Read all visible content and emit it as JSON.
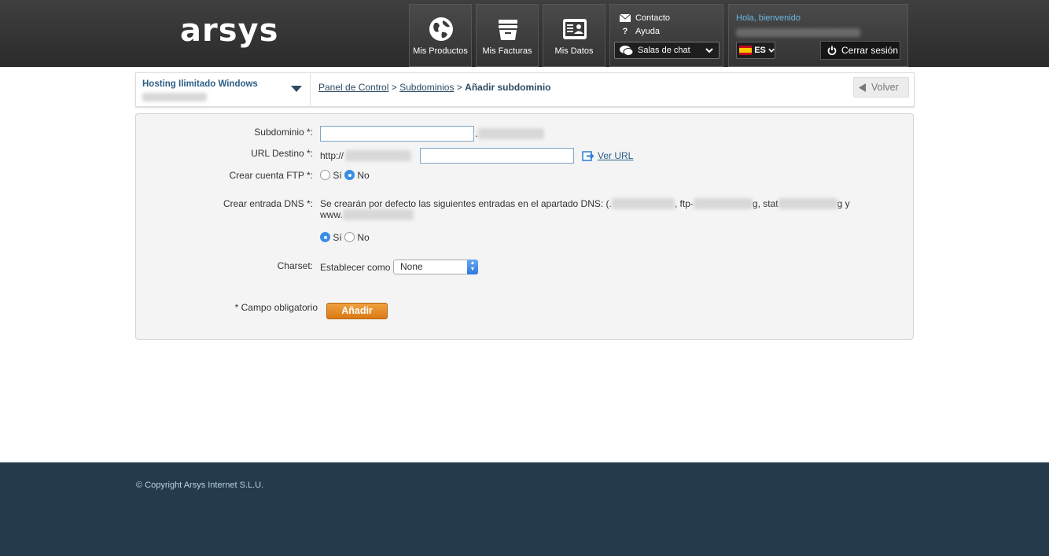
{
  "header": {
    "logo": "arsys",
    "nav": [
      {
        "label": "Mis Productos",
        "icon": "globe-icon"
      },
      {
        "label": "Mis Facturas",
        "icon": "basket-icon"
      },
      {
        "label": "Mis Datos",
        "icon": "id-card-icon"
      }
    ],
    "contact_label": "Contacto",
    "help_label": "Ayuda",
    "chat_label": "Salas de chat",
    "greeting": "Hola, bienvenido",
    "language": "ES",
    "logout_label": "Cerrar sesión"
  },
  "service": {
    "title": "Hosting Ilimitado Windows"
  },
  "breadcrumb": {
    "items": [
      "Panel de Control",
      "Subdominios"
    ],
    "separator": ">",
    "current": "Añadir subdominio"
  },
  "back_label": "Volver",
  "form": {
    "subdomain_label": "Subdominio *:",
    "subdomain_value": "",
    "url_label": "URL Destino *:",
    "url_prefix": "http://",
    "url_value": "",
    "ver_url_label": "Ver URL",
    "ftp_label": "Crear cuenta FTP *:",
    "ftp_options": [
      "Sí",
      "No"
    ],
    "ftp_selected": "No",
    "dns_label": "Crear entrada DNS *:",
    "dns_text_1": "Se crearán por defecto las siguientes entradas en el apartado DNS: (.",
    "dns_text_2": ", ftp-",
    "dns_text_3": "g, stat",
    "dns_text_4": "g y",
    "dns_text_5": "www.",
    "dns_options": [
      "Sí",
      "No"
    ],
    "dns_selected": "Sí",
    "charset_label": "Charset:",
    "charset_prefix": "Establecer como",
    "charset_value": "None",
    "required_note": "* Campo obligatorio",
    "submit_label": "Añadir"
  },
  "footer": {
    "copyright": "© Copyright Arsys Internet S.L.U."
  }
}
